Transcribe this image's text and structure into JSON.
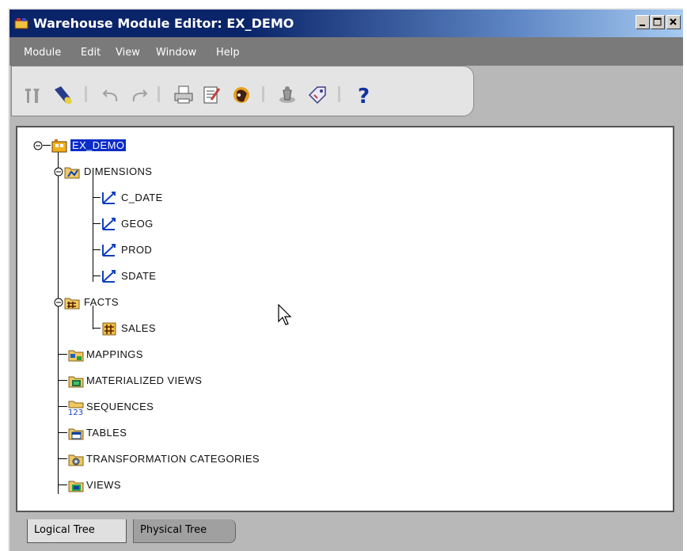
{
  "window": {
    "title": "Warehouse Module Editor: EX_DEMO"
  },
  "menu": [
    "Module",
    "Edit",
    "View",
    "Window",
    "Help"
  ],
  "toolbar": {
    "buttons": [
      "tools-icon",
      "flashlight-icon",
      "undo-icon",
      "redo-icon",
      "print-icon",
      "properties-icon",
      "wizard-icon",
      "object-icon",
      "tag-icon",
      "help-icon"
    ]
  },
  "tree": {
    "root": "EX_DEMO",
    "dimensions": {
      "label": "DIMENSIONS",
      "children": [
        "C_DATE",
        "GEOG",
        "PROD",
        "SDATE"
      ]
    },
    "facts": {
      "label": "FACTS",
      "children": [
        "SALES"
      ]
    },
    "others": [
      "MAPPINGS",
      "MATERIALIZED VIEWS",
      "SEQUENCES",
      "TABLES",
      "TRANSFORMATION CATEGORIES",
      "VIEWS"
    ]
  },
  "tabs": {
    "logical": "Logical Tree",
    "physical": "Physical Tree"
  },
  "colors": {
    "title_start": "#0a246a",
    "title_end": "#a6caf0",
    "selection": "#0a2cc8",
    "window_bg": "#b8b8b8"
  }
}
